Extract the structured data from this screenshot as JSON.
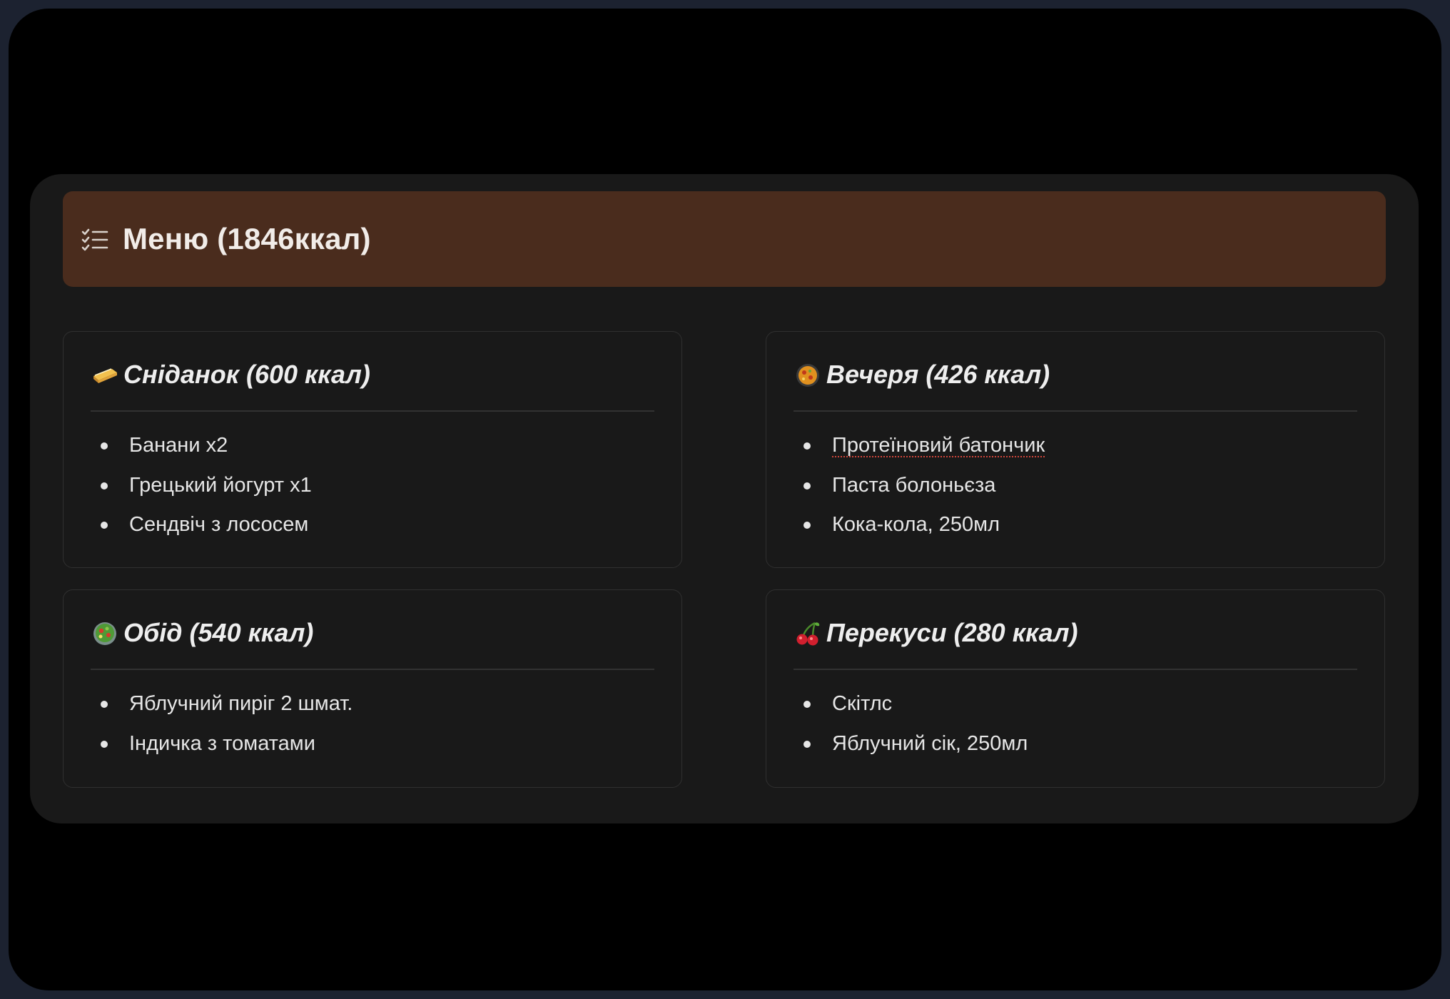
{
  "callout": {
    "icon": "checklist-icon",
    "title": "Меню (1846ккал)",
    "background": "#4a2c1d"
  },
  "meals": [
    {
      "icon": "bread-icon",
      "title": "Сніданок (600 ккал)",
      "items": [
        "Банани x2",
        "Грецький йогурт x1",
        "Сендвіч з лососем"
      ]
    },
    {
      "icon": "paella-icon",
      "title": "Вечеря (426 ккал)",
      "items": [
        "Протеїновий батончик",
        "Паста болоньєза",
        "Кока-кола, 250мл"
      ]
    },
    {
      "icon": "salad-icon",
      "title": "Обід (540 ккал)",
      "items": [
        "Яблучний пиріг 2 шмат.",
        "Індичка з томатами"
      ]
    },
    {
      "icon": "cherries-icon",
      "title": "Перекуси (280 ккал)",
      "items": [
        "Скітлс",
        "Яблучний сік, 250мл"
      ]
    }
  ]
}
